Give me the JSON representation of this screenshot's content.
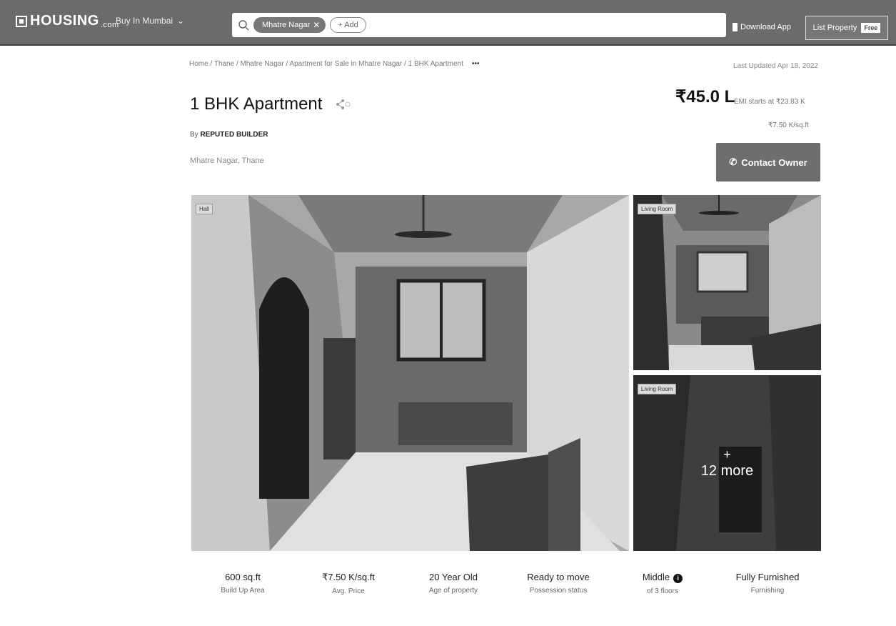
{
  "header": {
    "logo": "HOUSING",
    "logo_suffix": ".com",
    "city_select": "Buy In Mumbai",
    "search_chip": "Mhatre Nagar",
    "add_chip": "+ Add",
    "download_app": "Download App",
    "list_property": "List Property",
    "free_badge": "Free"
  },
  "breadcrumb": {
    "text": "Home / Thane / Mhatre Nagar / Apartment for Sale in Mhatre Nagar / 1 BHK Apartment",
    "more": "•••"
  },
  "last_updated": "Last Updated Apr 18, 2022",
  "listing": {
    "title": "1 BHK Apartment",
    "builder_prefix": "By",
    "builder_name": "REPUTED BUILDER",
    "locality": "Mhatre Nagar, Thane",
    "price": "₹45.0 L",
    "emi": "EMI starts at ₹23.83 K",
    "price_per_sqft": "₹7.50 K/sq.ft",
    "contact_button": "Contact Owner"
  },
  "photos": {
    "main_tag": "Hall",
    "side1_tag": "Living Room",
    "side2_tag": "Living Room",
    "more_plus": "+",
    "more_text": "12 more"
  },
  "stats": [
    {
      "value": "600 sq.ft",
      "label": "Build Up Area"
    },
    {
      "value": "₹7.50 K/sq.ft",
      "label": "Avg. Price"
    },
    {
      "value": "20 Year Old",
      "label": "Age of property"
    },
    {
      "value": "Ready to move",
      "label": "Possession status"
    },
    {
      "value": "Middle",
      "label": "of 3 floors"
    },
    {
      "value": "Fully Furnished",
      "label": "Furnishing"
    }
  ]
}
